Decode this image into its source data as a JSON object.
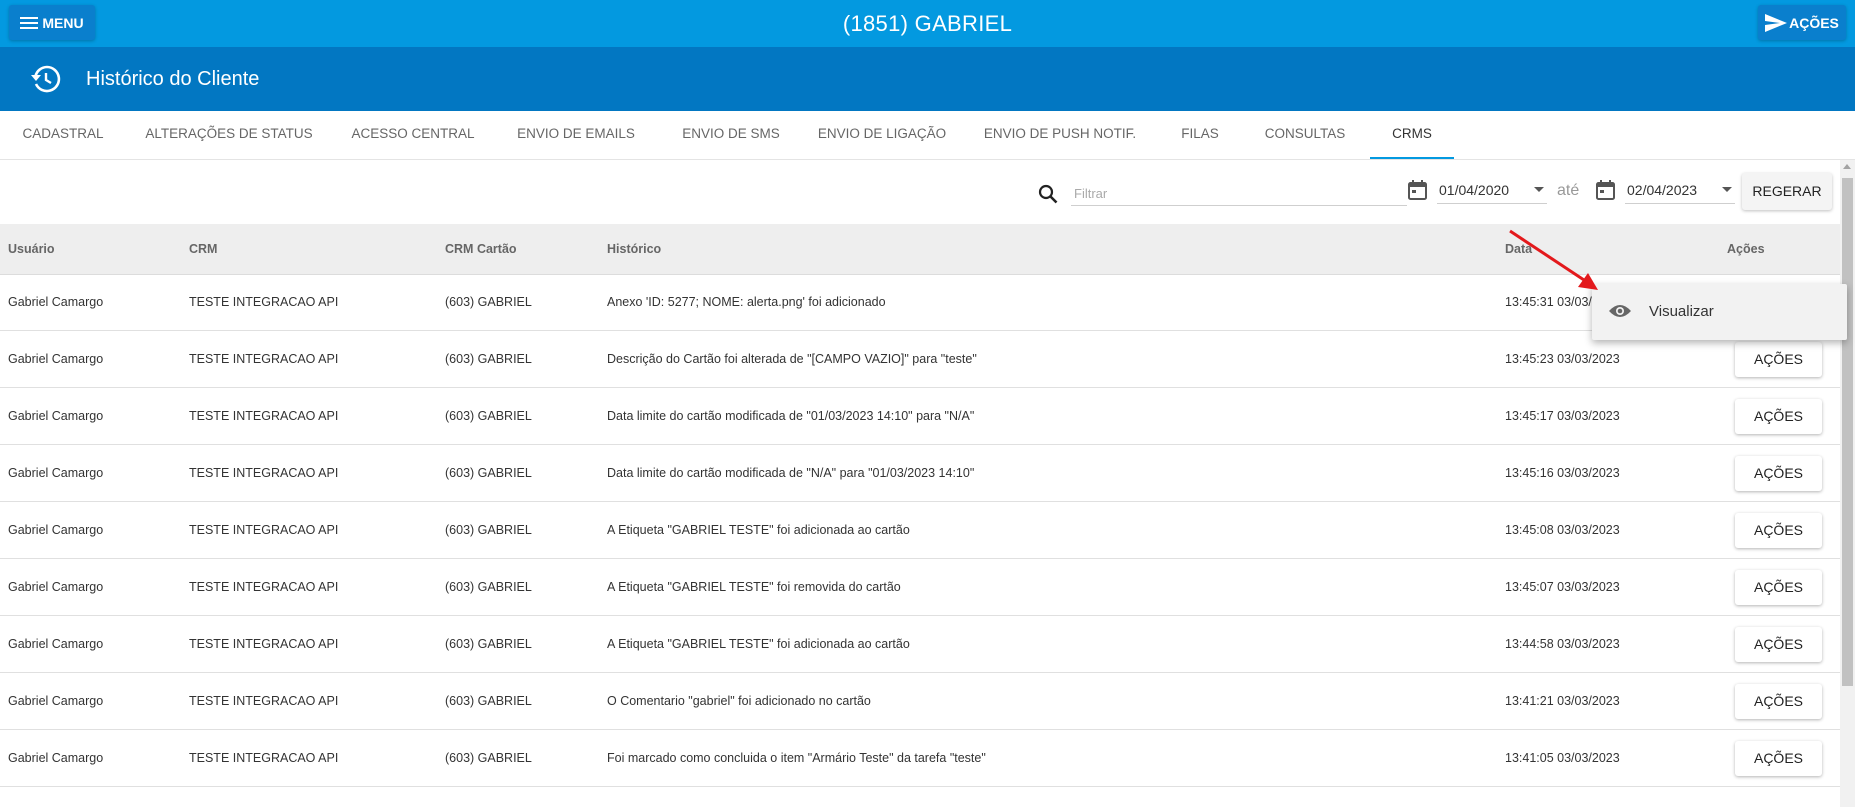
{
  "header": {
    "menu_label": "MENU",
    "title": "(1851) GABRIEL",
    "actions_label": "AÇÕES",
    "accent_color": "#0399e0"
  },
  "subheader": {
    "icon": "history-icon",
    "title": "Histórico do Cliente",
    "color": "#0277c2"
  },
  "tabs": [
    {
      "label": "CADASTRAL"
    },
    {
      "label": "ALTERAÇÕES DE STATUS"
    },
    {
      "label": "ACESSO CENTRAL"
    },
    {
      "label": "ENVIO DE EMAILS"
    },
    {
      "label": "ENVIO DE SMS"
    },
    {
      "label": "ENVIO DE LIGAÇÃO"
    },
    {
      "label": "ENVIO DE PUSH NOTIF."
    },
    {
      "label": "FILAS"
    },
    {
      "label": "CONSULTAS"
    },
    {
      "label": "CRMS",
      "active": true
    }
  ],
  "filters": {
    "search_placeholder": "Filtrar",
    "date_from": "01/04/2020",
    "separator": "até",
    "date_to": "02/04/2023",
    "regenerate_label": "REGERAR"
  },
  "table": {
    "columns": [
      "Usuário",
      "CRM",
      "CRM Cartão",
      "Histórico",
      "Data",
      "Ações"
    ],
    "action_label": "AÇÕES",
    "rows": [
      {
        "usuario": "Gabriel Camargo",
        "crm": "TESTE INTEGRACAO API",
        "cartao": "(603) GABRIEL",
        "historico": "Anexo 'ID: 5277; NOME: alerta.png' foi adicionado",
        "data": "13:45:31 03/03/2023"
      },
      {
        "usuario": "Gabriel Camargo",
        "crm": "TESTE INTEGRACAO API",
        "cartao": "(603) GABRIEL",
        "historico": "Descrição do Cartão foi alterada de \"[CAMPO VAZIO]\" para \"teste\"",
        "data": "13:45:23 03/03/2023"
      },
      {
        "usuario": "Gabriel Camargo",
        "crm": "TESTE INTEGRACAO API",
        "cartao": "(603) GABRIEL",
        "historico": "Data limite do cartão modificada de \"01/03/2023 14:10\" para \"N/A\"",
        "data": "13:45:17 03/03/2023"
      },
      {
        "usuario": "Gabriel Camargo",
        "crm": "TESTE INTEGRACAO API",
        "cartao": "(603) GABRIEL",
        "historico": "Data limite do cartão modificada de \"N/A\" para \"01/03/2023 14:10\"",
        "data": "13:45:16 03/03/2023"
      },
      {
        "usuario": "Gabriel Camargo",
        "crm": "TESTE INTEGRACAO API",
        "cartao": "(603) GABRIEL",
        "historico": "A Etiqueta \"GABRIEL TESTE\" foi adicionada ao cartão",
        "data": "13:45:08 03/03/2023"
      },
      {
        "usuario": "Gabriel Camargo",
        "crm": "TESTE INTEGRACAO API",
        "cartao": "(603) GABRIEL",
        "historico": "A Etiqueta \"GABRIEL TESTE\" foi removida do cartão",
        "data": "13:45:07 03/03/2023"
      },
      {
        "usuario": "Gabriel Camargo",
        "crm": "TESTE INTEGRACAO API",
        "cartao": "(603) GABRIEL",
        "historico": "A Etiqueta \"GABRIEL TESTE\" foi adicionada ao cartão",
        "data": "13:44:58 03/03/2023"
      },
      {
        "usuario": "Gabriel Camargo",
        "crm": "TESTE INTEGRACAO API",
        "cartao": "(603) GABRIEL",
        "historico": "O Comentario \"gabriel\" foi adicionado no cartão",
        "data": "13:41:21 03/03/2023"
      },
      {
        "usuario": "Gabriel Camargo",
        "crm": "TESTE INTEGRACAO API",
        "cartao": "(603) GABRIEL",
        "historico": "Foi marcado como concluida o item \"Armário Teste\" da tarefa \"teste\"",
        "data": "13:41:05 03/03/2023"
      }
    ]
  },
  "dropdown": {
    "icon": "eye-icon",
    "label": "Visualizar"
  },
  "annotation": {
    "arrow_color": "#e3191c"
  }
}
